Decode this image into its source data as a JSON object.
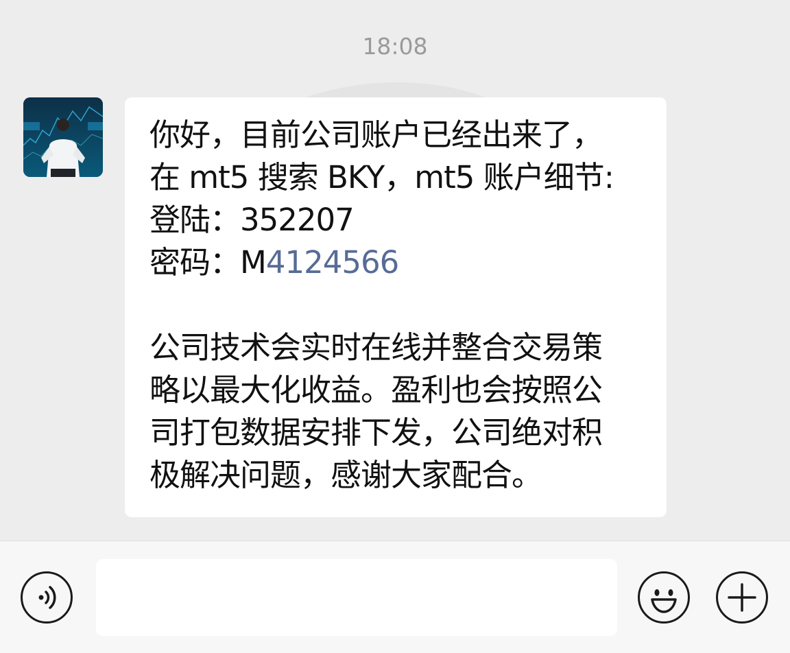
{
  "chat": {
    "timestamp": "18:08"
  },
  "message": {
    "avatar_icon": "trader-avatar",
    "lines": [
      "你好，目前公司账户已经出来了，",
      "在 mt5 搜索 BKY，mt5 账户细节:",
      "登陆：352207"
    ],
    "password_label": "密码：M",
    "password_link": "4124566",
    "paragraph2": [
      "公司技术会实时在线并整合交易策",
      "略以最大化收益。盈利也会按照公",
      "司打包数据安排下发，公司绝对积",
      "极解决问题，感谢大家配合。"
    ],
    "link_color": "#576b95"
  },
  "input_bar": {
    "voice_icon": "voice-icon",
    "emoji_icon": "emoji-icon",
    "plus_icon": "plus-icon",
    "input_value": ""
  }
}
